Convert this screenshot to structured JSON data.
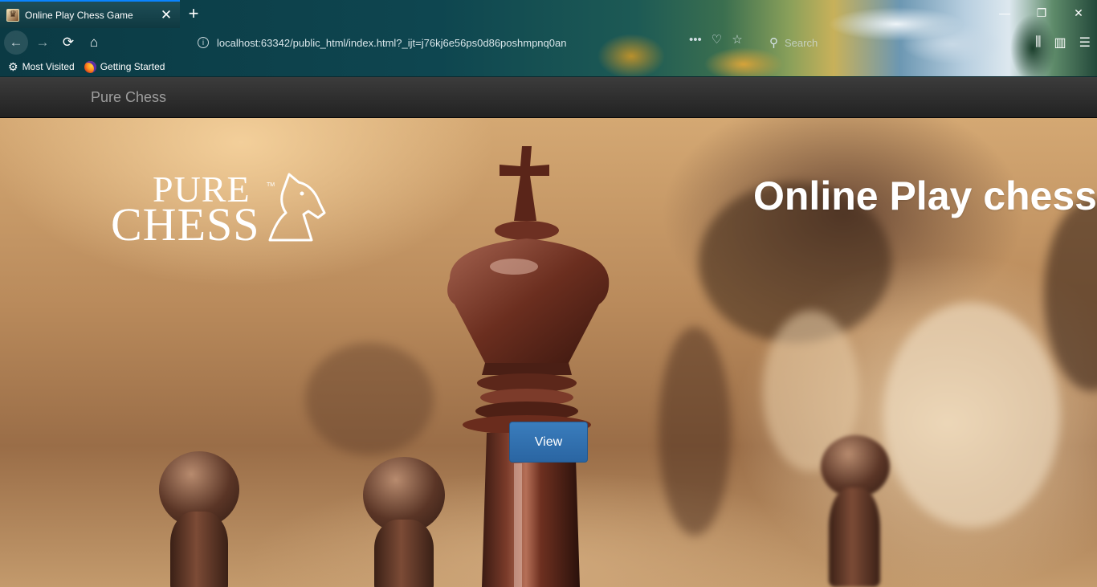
{
  "browser": {
    "tab": {
      "title": "Online Play Chess Game",
      "favicon": "chess-favicon-icon",
      "close": "✕"
    },
    "new_tab": "+",
    "window_controls": {
      "minimize": "—",
      "restore": "❐",
      "close": "✕"
    },
    "nav": {
      "back": "←",
      "forward": "→",
      "reload": "⟳",
      "home": "⌂"
    },
    "url": "localhost:63342/public_html/index.html?_ijt=j76kj6e56ps0d86poshmpnq0an",
    "url_actions": {
      "more": "•••",
      "pocket": "♡",
      "bookmark_star": "☆"
    },
    "search_placeholder": "Search",
    "right_tools": {
      "library": "⫼",
      "sidebar": "▥",
      "menu": "☰"
    },
    "bookmarks": [
      {
        "label": "Most Visited",
        "icon": "gear-icon"
      },
      {
        "label": "Getting Started",
        "icon": "firefox-icon"
      }
    ]
  },
  "site": {
    "brand": "Pure Chess",
    "logo": {
      "line1": "PURE",
      "line2": "CHESS",
      "tm": "TM"
    },
    "hero_title": "Online Play chess",
    "view_button": "View"
  },
  "colors": {
    "accent": "#0a84ff",
    "navbar": "#222222",
    "button": "#337ab7"
  }
}
